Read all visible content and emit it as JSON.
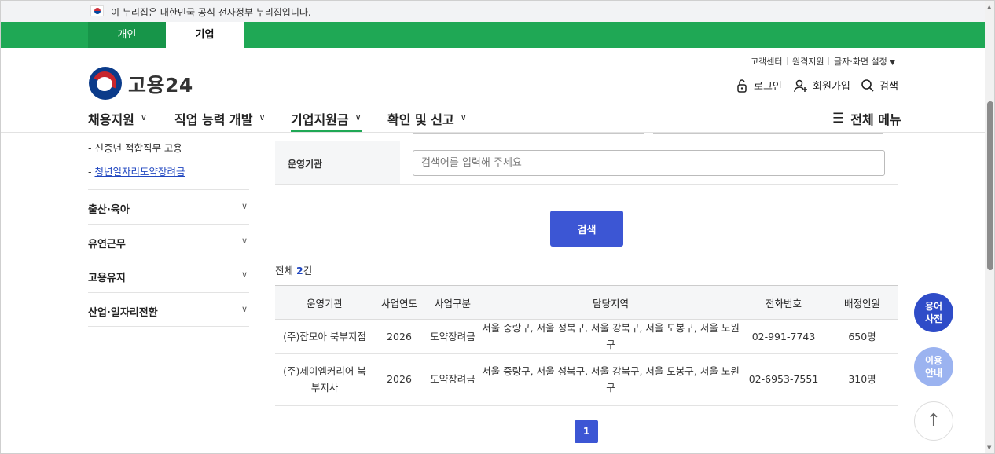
{
  "gov_banner": {
    "text": "이 누리집은 대한민국 공식 전자정부 누리집입니다."
  },
  "user_tabs": [
    {
      "label": "개인"
    },
    {
      "label": "기업",
      "active": true
    }
  ],
  "header": {
    "logo_text": "고용24",
    "util_links": [
      "고객센터",
      "원격지원",
      "글자·화면 설정"
    ],
    "actions": {
      "login": "로그인",
      "signup": "회원가입",
      "search": "검색"
    },
    "gnb": [
      "채용지원",
      "직업 능력 개발",
      "기업지원금",
      "확인 및 신고"
    ],
    "active_gnb": "기업지원금",
    "all_menu": "전체 메뉴"
  },
  "sidebar": {
    "sub_links": [
      "신중년 적합직무 고용",
      "청년일자리도약장려금"
    ],
    "active_sub": "청년일자리도약장려금",
    "accordions": [
      "출산·육아",
      "유연근무",
      "고용유지",
      "산업·일자리전환"
    ]
  },
  "search_form": {
    "field_label": "운영기관",
    "placeholder": "검색어를 입력해 주세요",
    "value": "",
    "button": "검색"
  },
  "results": {
    "total_prefix": "전체",
    "total_count": "2",
    "total_suffix": "건",
    "columns": [
      "운영기관",
      "사업연도",
      "사업구분",
      "담당지역",
      "전화번호",
      "배정인원"
    ],
    "rows": [
      {
        "org": "(주)잡모아 북부지점",
        "year": "2026",
        "type": "도약장려금",
        "region": "서울 중랑구, 서울 성북구, 서울 강북구, 서울 도봉구, 서울 노원구",
        "phone": "02-991-7743",
        "quota": "650명"
      },
      {
        "org": "(주)제이엠커리어 북부지사",
        "year": "2026",
        "type": "도약장려금",
        "region": "서울 중랑구, 서울 성북구, 서울 강북구, 서울 도봉구, 서울 노원구",
        "phone": "02-6953-7551",
        "quota": "310명"
      }
    ]
  },
  "pagination": {
    "current": "1"
  },
  "floating": {
    "dictionary": "용어\n사전",
    "guide": "이용\n안내",
    "top": "↑"
  },
  "colors": {
    "brand_green": "#1fa855",
    "primary_blue": "#3c56d4",
    "link_blue": "#2147c0"
  }
}
